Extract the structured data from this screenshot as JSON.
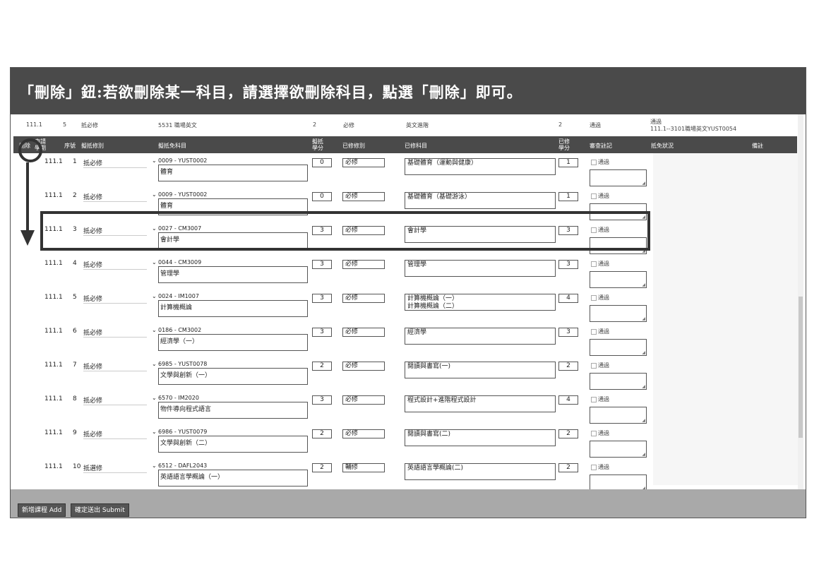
{
  "banner": {
    "title": "「刪除」鈕:若欲刪除某一科目，請選擇欲刪除科目，點選「刪除」即可。"
  },
  "prev_row": {
    "term": "111.1",
    "seq": "5",
    "type": "抵必修",
    "course": "5531 職場英文",
    "credit": "2",
    "req": "必修",
    "subject": "英文進階",
    "ecredit": "2",
    "status": "通過",
    "result_l1": "通過",
    "result_l2": "111.1--3101職場英文YUST0054"
  },
  "header": {
    "delete": "刪除",
    "term": "申請學期",
    "seq": "序號",
    "type": "擬抵修別",
    "course": "擬抵免科目",
    "credit": "擬抵學分",
    "req": "已修修別",
    "subject": "已修科目",
    "ecredit": "已修學分",
    "review": "審查註記",
    "result": "抵免狀況",
    "remarks": "備註"
  },
  "rows": [
    {
      "term": "111.1",
      "seq": "1",
      "type": "抵必修",
      "code": "0009 - YUST0002",
      "name": "體育",
      "credit": "0",
      "req": "必修",
      "subject": "基礎體育（運動與健康）",
      "ecredit": "1",
      "status": "通過"
    },
    {
      "term": "111.1",
      "seq": "2",
      "type": "抵必修",
      "code": "0009 - YUST0002",
      "name": "體育",
      "credit": "0",
      "req": "必修",
      "subject": "基礎體育（基礎游泳）",
      "ecredit": "1",
      "status": "通過"
    },
    {
      "term": "111.1",
      "seq": "3",
      "type": "抵必修",
      "code": "0027 - CM3007",
      "name": "會計學",
      "credit": "3",
      "req": "必修",
      "subject": "會計學",
      "ecredit": "3",
      "status": "通過"
    },
    {
      "term": "111.1",
      "seq": "4",
      "type": "抵必修",
      "code": "0044 - CM3009",
      "name": "管理學",
      "credit": "3",
      "req": "必修",
      "subject": "管理學",
      "ecredit": "3",
      "status": "通過"
    },
    {
      "term": "111.1",
      "seq": "5",
      "type": "抵必修",
      "code": "0024 - IM1007",
      "name": "計算機概論",
      "credit": "3",
      "req": "必修",
      "subject": "計算機概論（一）\n計算機概論（二）",
      "ecredit": "4",
      "status": "通過"
    },
    {
      "term": "111.1",
      "seq": "6",
      "type": "抵必修",
      "code": "0186 - CM3002",
      "name": "經濟學（一）",
      "credit": "3",
      "req": "必修",
      "subject": "經濟學",
      "ecredit": "3",
      "status": "通過"
    },
    {
      "term": "111.1",
      "seq": "7",
      "type": "抵必修",
      "code": "6985 - YUST0078",
      "name": "文學與創新（一）",
      "credit": "2",
      "req": "必修",
      "subject": "閱讀與書寫(一)",
      "ecredit": "2",
      "status": "通過"
    },
    {
      "term": "111.1",
      "seq": "8",
      "type": "抵必修",
      "code": "6570 - IM2020",
      "name": "物件導向程式語言",
      "credit": "3",
      "req": "必修",
      "subject": "程式設計+進階程式設計",
      "ecredit": "4",
      "status": "通過"
    },
    {
      "term": "111.1",
      "seq": "9",
      "type": "抵必修",
      "code": "6986 - YUST0079",
      "name": "文學與創新（二）",
      "credit": "2",
      "req": "必修",
      "subject": "閱讀與書寫(二)",
      "ecredit": "2",
      "status": "通過"
    },
    {
      "term": "111.1",
      "seq": "10",
      "type": "抵選修",
      "code": "6512 - DAFL2043",
      "name": "英語語言學概論（一）",
      "credit": "2",
      "req": "輔修",
      "subject": "英語語言學概論(二)",
      "ecredit": "2",
      "status": "通過"
    }
  ],
  "buttons": {
    "add": "新增課程 Add",
    "submit": "確定送出 Submit"
  }
}
